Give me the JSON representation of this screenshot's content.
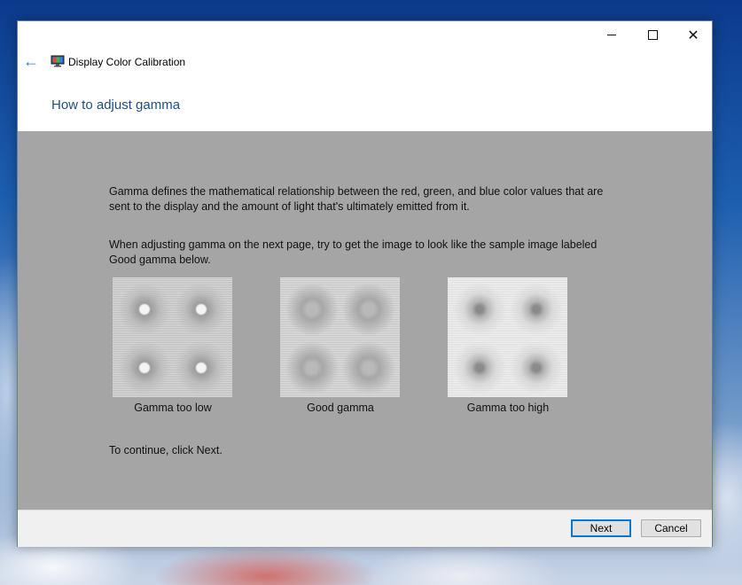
{
  "window": {
    "app_title": "Display Color Calibration",
    "page_title": "How to adjust gamma",
    "caption_buttons": {
      "minimize": "minimize-icon",
      "maximize": "maximize-icon",
      "close": "✕"
    },
    "back_icon": "←"
  },
  "content": {
    "paragraph_1": "Gamma defines the mathematical relationship between the red, green, and blue color values that are sent to the display and the amount of light that's ultimately emitted from it.",
    "paragraph_2": "When adjusting gamma on the next page, try to get the image to look like the sample image labeled Good gamma below.",
    "samples": [
      {
        "label": "Gamma too low"
      },
      {
        "label": "Good gamma"
      },
      {
        "label": "Gamma too high"
      }
    ],
    "continue_text": "To continue, click Next."
  },
  "footer": {
    "next_label": "Next",
    "cancel_label": "Cancel"
  },
  "colors": {
    "accent": "#0078d7",
    "page_title": "#1e4e85",
    "content_bg": "#a5a5a5"
  }
}
